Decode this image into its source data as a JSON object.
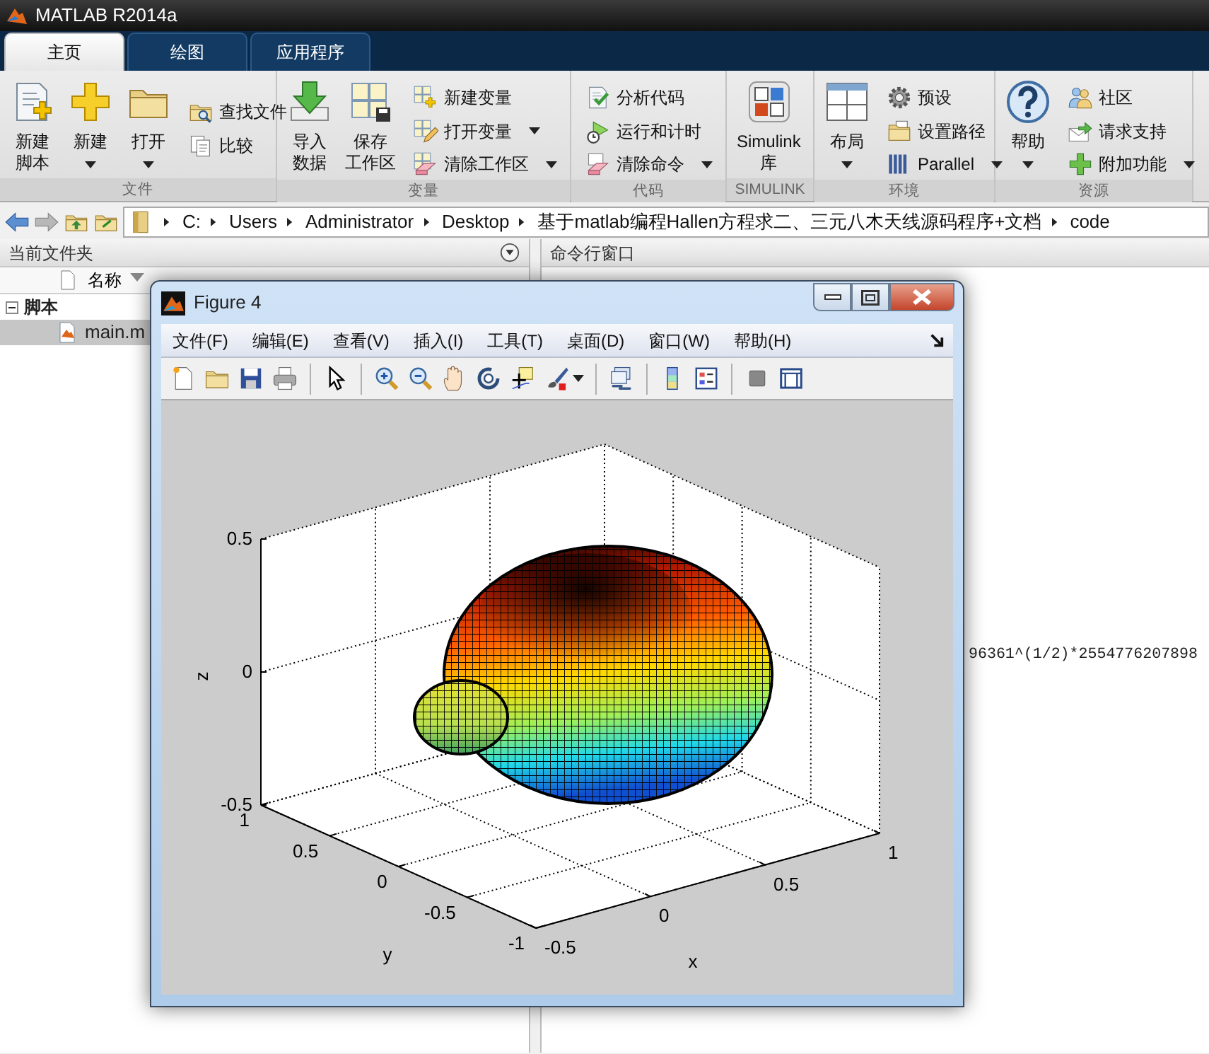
{
  "app": {
    "title": "MATLAB R2014a"
  },
  "tabs": [
    {
      "label": "主页",
      "selected": true
    },
    {
      "label": "绘图",
      "selected": false
    },
    {
      "label": "应用程序",
      "selected": false
    }
  ],
  "ribbon": {
    "groups": [
      {
        "label": "文件",
        "items": [
          {
            "kind": "large",
            "label": [
              "新建",
              "脚本"
            ],
            "dropdown": false
          },
          {
            "kind": "large",
            "label": [
              "新建"
            ],
            "dropdown": true
          },
          {
            "kind": "large",
            "label": [
              "打开"
            ],
            "dropdown": true
          },
          {
            "kind": "small",
            "label": "查找文件",
            "dropdown": false
          },
          {
            "kind": "small",
            "label": "比较",
            "dropdown": false
          }
        ]
      },
      {
        "label": "变量",
        "items": [
          {
            "kind": "large",
            "label": [
              "导入",
              "数据"
            ],
            "dropdown": false
          },
          {
            "kind": "large",
            "label": [
              "保存",
              "工作区"
            ],
            "dropdown": false
          },
          {
            "kind": "small",
            "label": "新建变量",
            "dropdown": false
          },
          {
            "kind": "small",
            "label": "打开变量",
            "dropdown": true
          },
          {
            "kind": "small",
            "label": "清除工作区",
            "dropdown": true
          }
        ]
      },
      {
        "label": "代码",
        "items": [
          {
            "kind": "small",
            "label": "分析代码",
            "dropdown": false
          },
          {
            "kind": "small",
            "label": "运行和计时",
            "dropdown": false
          },
          {
            "kind": "small",
            "label": "清除命令",
            "dropdown": true
          }
        ]
      },
      {
        "label": "SIMULINK",
        "items": [
          {
            "kind": "large",
            "label": [
              "Simulink",
              "库"
            ],
            "dropdown": false
          }
        ]
      },
      {
        "label": "环境",
        "items": [
          {
            "kind": "large",
            "label": [
              "布局"
            ],
            "dropdown": true
          },
          {
            "kind": "small",
            "label": "预设",
            "dropdown": false
          },
          {
            "kind": "small",
            "label": "设置路径",
            "dropdown": false
          },
          {
            "kind": "small",
            "label": "Parallel",
            "dropdown": true
          }
        ]
      },
      {
        "label": "资源",
        "items": [
          {
            "kind": "large",
            "label": [
              "帮助"
            ],
            "dropdown": true
          },
          {
            "kind": "small",
            "label": "社区",
            "dropdown": false
          },
          {
            "kind": "small",
            "label": "请求支持",
            "dropdown": false
          },
          {
            "kind": "small",
            "label": "附加功能",
            "dropdown": true
          }
        ]
      }
    ]
  },
  "address_bar": {
    "segments": [
      "C:",
      "Users",
      "Administrator",
      "Desktop",
      "基于matlab编程Hallen方程求二、三元八木天线源码程序+文档",
      "code"
    ]
  },
  "current_folder": {
    "title": "当前文件夹",
    "column": "名称",
    "tree": [
      {
        "label": "脚本",
        "selected": false,
        "expanded": true,
        "children": [
          {
            "label": "main.m",
            "selected": true
          }
        ]
      }
    ]
  },
  "command_window": {
    "title": "命令行窗口",
    "lines": [
      "96361^(1/2)*2554776207898"
    ]
  },
  "figure": {
    "title": "Figure 4",
    "menu": [
      "文件(F)",
      "编辑(E)",
      "查看(V)",
      "插入(I)",
      "工具(T)",
      "桌面(D)",
      "窗口(W)",
      "帮助(H)"
    ],
    "axes": {
      "zlabel": "z",
      "ylabel": "y",
      "xlabel": "x",
      "zticks": [
        "0.5",
        "0",
        "-0.5"
      ],
      "yticks": [
        "1",
        "0.5",
        "0",
        "-0.5",
        "-1"
      ],
      "xticks": [
        "-0.5",
        "0",
        "0.5",
        "1"
      ]
    }
  }
}
